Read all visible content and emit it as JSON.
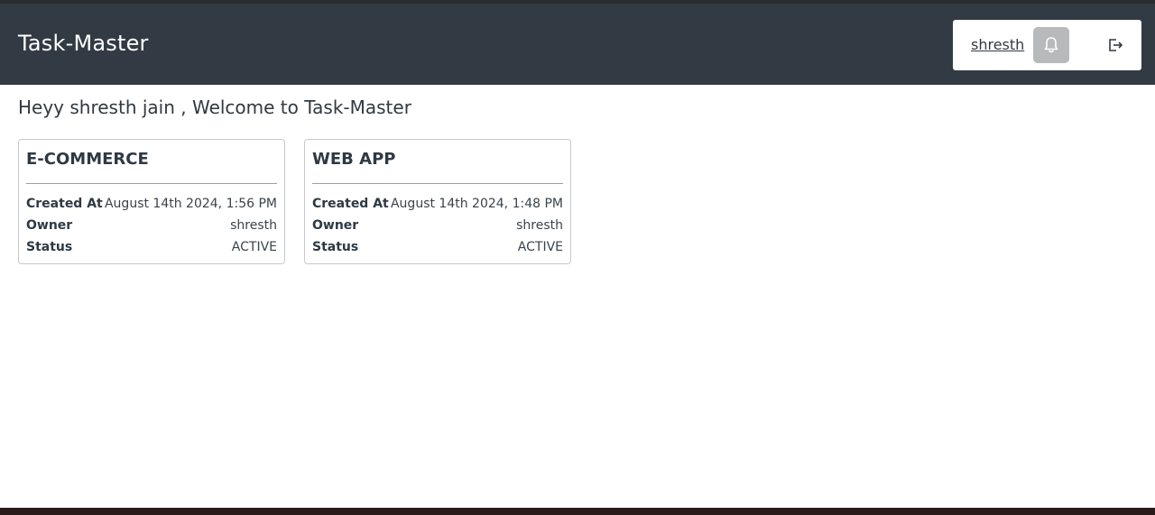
{
  "app": {
    "title": "Task-Master"
  },
  "header": {
    "username": "shresth",
    "bell_icon": "bell-icon",
    "logout_icon": "logout-icon"
  },
  "welcome": {
    "text": "Heyy shresth jain , Welcome to Task-Master"
  },
  "projects": [
    {
      "title": "E-COMMERCE",
      "created_label": "Created At",
      "created_value": "August 14th 2024, 1:56 PM",
      "owner_label": "Owner",
      "owner_value": "shresth",
      "status_label": "Status",
      "status_value": "ACTIVE"
    },
    {
      "title": "WEB APP",
      "created_label": "Created At",
      "created_value": "August 14th 2024, 1:48 PM",
      "owner_label": "Owner",
      "owner_value": "shresth",
      "status_label": "Status",
      "status_value": "ACTIVE"
    }
  ],
  "colors": {
    "navbar": "#323b44",
    "text": "#2f3943",
    "bell_bg": "#b7b9bb"
  }
}
